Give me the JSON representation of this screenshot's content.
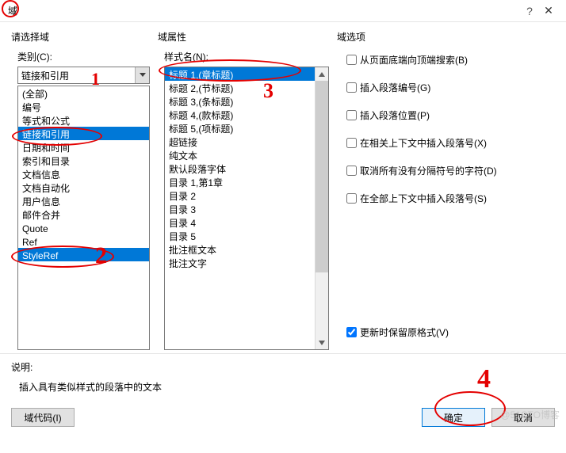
{
  "title": "域",
  "helpIcon": "?",
  "closeIcon": "✕",
  "col1": {
    "header": "请选择域",
    "categoryLabel": "类别(C):",
    "categoryText": "链接和引用",
    "items": [
      "(全部)",
      "编号",
      "等式和公式",
      "链接和引用",
      "日期和时间",
      "索引和目录",
      "文档信息",
      "文档自动化",
      "用户信息",
      "邮件合并",
      "Quote",
      "Ref",
      "StyleRef"
    ],
    "selectedIndex": 3,
    "selectedIndex2": 12
  },
  "col2": {
    "header": "域属性",
    "styleLabel": "样式名(N):",
    "items": [
      "标题 1,(章标题)",
      "标题 2,(节标题)",
      "标题 3,(条标题)",
      "标题 4,(款标题)",
      "标题 5,(项标题)",
      "超链接",
      "纯文本",
      "默认段落字体",
      "目录 1,第1章",
      "目录 2",
      "目录 3",
      "目录 4",
      "目录 5",
      "批注框文本",
      "批注文字"
    ],
    "selectedIndex": 0
  },
  "col3": {
    "header": "域选项",
    "options": [
      {
        "label": "从页面底端向顶端搜索(B)",
        "checked": false
      },
      {
        "label": "插入段落编号(G)",
        "checked": false
      },
      {
        "label": "插入段落位置(P)",
        "checked": false
      },
      {
        "label": "在相关上下文中插入段落号(X)",
        "checked": false
      },
      {
        "label": "取消所有没有分隔符号的字符(D)",
        "checked": false
      },
      {
        "label": "在全部上下文中插入段落号(S)",
        "checked": false
      }
    ],
    "preserve": {
      "label": "更新时保留原格式(V)",
      "checked": true
    }
  },
  "desc": {
    "label": "说明:",
    "text": "插入具有类似样式的段落中的文本"
  },
  "buttons": {
    "fieldCodes": "域代码(I)",
    "ok": "确定",
    "cancel": "取消"
  },
  "annotations": {
    "n1": "1",
    "n2": "2",
    "n3": "3",
    "n4": "4"
  },
  "watermark": "@51CTO博客"
}
